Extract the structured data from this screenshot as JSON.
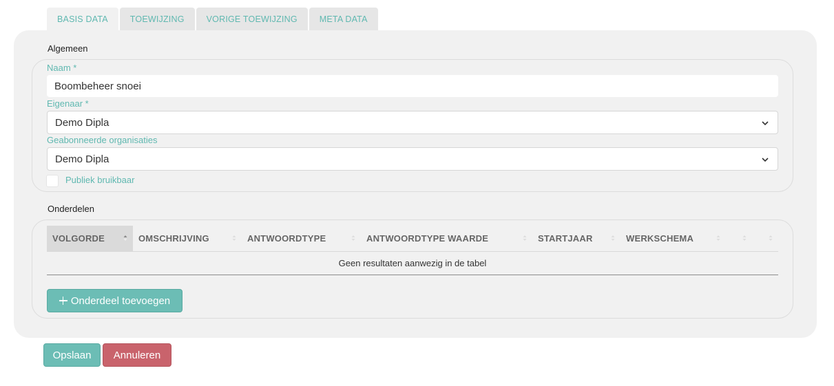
{
  "tabs": [
    {
      "label": "BASIS DATA",
      "active": true
    },
    {
      "label": "TOEWIJZING",
      "active": false
    },
    {
      "label": "VORIGE TOEWIJZING",
      "active": false
    },
    {
      "label": "META DATA",
      "active": false
    }
  ],
  "general": {
    "section_title": "Algemeen",
    "name_label": "Naam *",
    "name_value": "Boombeheer snoei",
    "owner_label": "Eigenaar *",
    "owner_value": "Demo Dipla",
    "subscribed_label": "Geabonneerde organisaties",
    "subscribed_value": "Demo Dipla",
    "public_label": "Publiek bruikbaar",
    "public_checked": false
  },
  "parts": {
    "section_title": "Onderdelen",
    "columns": [
      "VOLGORDE",
      "OMSCHRIJVING",
      "ANTWOORDTYPE",
      "ANTWOORDTYPE WAARDE",
      "STARTJAAR",
      "WERKSCHEMA",
      "",
      ""
    ],
    "empty_message": "Geen resultaten aanwezig in de tabel",
    "add_button": "Onderdeel toevoegen"
  },
  "actions": {
    "save": "Opslaan",
    "cancel": "Annuleren"
  },
  "colors": {
    "accent": "#6cbdb5",
    "danger": "#c9636c",
    "label": "#5fb8b0"
  },
  "icons": {
    "select_chevron": "chevron-down-icon",
    "sort": "sort-icon",
    "add": "plus-icon"
  }
}
